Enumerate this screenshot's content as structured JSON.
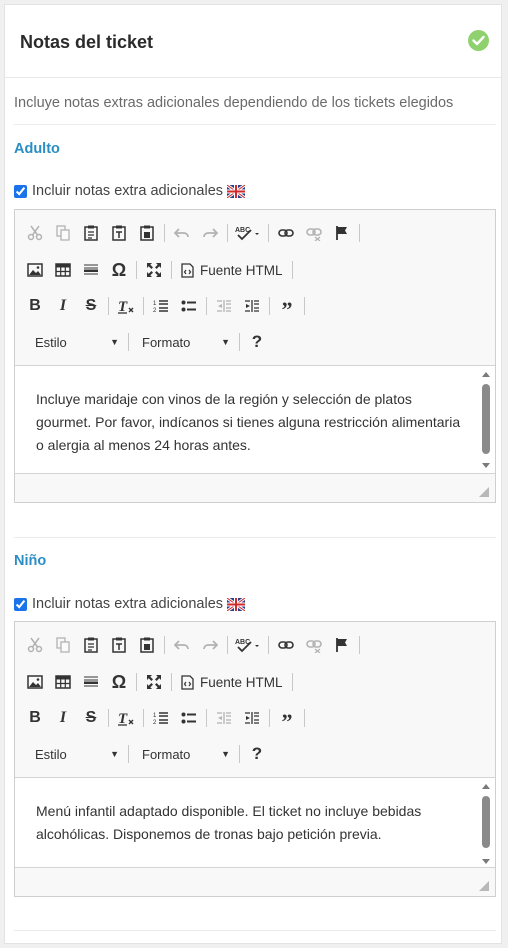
{
  "panel": {
    "title": "Notas del ticket",
    "description": "Incluye notas extras adicionales dependiendo de los tickets elegidos"
  },
  "sections": [
    {
      "title": "Adulto",
      "checkbox_label": "Incluir notas extra adicionales",
      "checked": true,
      "editor": {
        "html_button_label": "Fuente HTML",
        "style_label": "Estilo",
        "format_label": "Formato",
        "help_label": "?",
        "content": "Incluye maridaje con vinos de la región y selección de platos gourmet. Por favor, indícanos si tienes alguna restricción alimentaria o alergia al menos 24 horas antes."
      }
    },
    {
      "title": "Niño",
      "checkbox_label": "Incluir notas extra adicionales",
      "checked": true,
      "editor": {
        "html_button_label": "Fuente HTML",
        "style_label": "Estilo",
        "format_label": "Formato",
        "help_label": "?",
        "content": "Menú infantil adaptado disponible. El ticket no incluye bebidas alcohólicas. Disponemos de tronas bajo petición previa."
      }
    }
  ],
  "colors": {
    "accent": "#2a8ec4",
    "success": "#8fd16f"
  },
  "icons": [
    "check-icon",
    "uk-flag-icon",
    "cut-icon",
    "copy-icon",
    "paste-icon",
    "paste-text-icon",
    "paste-word-icon",
    "undo-icon",
    "redo-icon",
    "spellcheck-icon",
    "link-icon",
    "unlink-icon",
    "anchor-flag-icon",
    "image-icon",
    "table-icon",
    "horizontal-rule-icon",
    "omega-icon",
    "maximize-icon",
    "source-icon",
    "bold-icon",
    "italic-icon",
    "strikethrough-icon",
    "remove-format-icon",
    "numbered-list-icon",
    "bulleted-list-icon",
    "outdent-icon",
    "indent-icon",
    "blockquote-icon",
    "help-icon"
  ]
}
